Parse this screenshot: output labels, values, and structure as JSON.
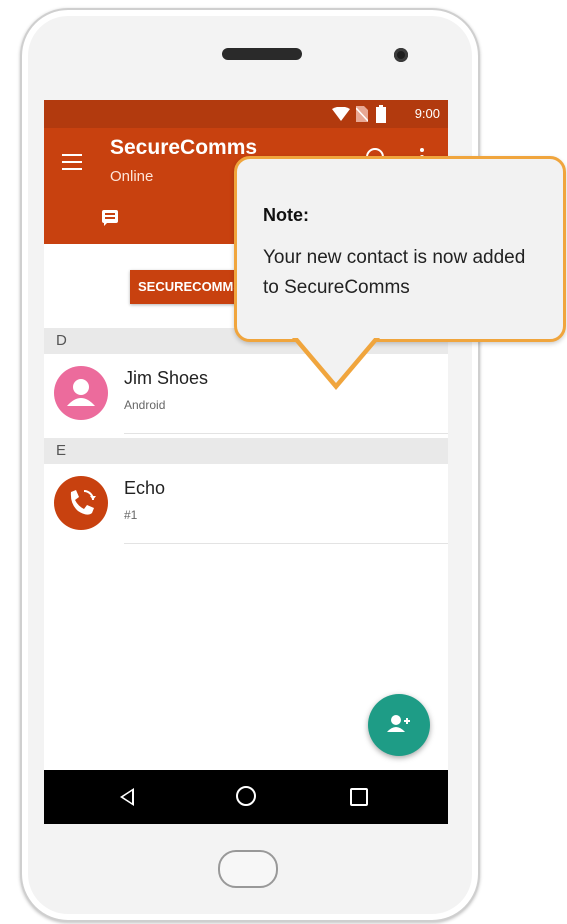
{
  "status_bar": {
    "time": "9:00",
    "icons": [
      "wifi-icon",
      "no-sim-icon",
      "battery-icon"
    ]
  },
  "app_bar": {
    "title": "SecureComms",
    "subtitle": "Online",
    "icons": [
      "menu-icon",
      "search-icon",
      "more-vert-icon",
      "chat-icon"
    ]
  },
  "promo_button": {
    "label": "SECURECOMMS"
  },
  "sections": [
    {
      "letter": "D",
      "contacts": [
        {
          "name": "Jim Shoes",
          "detail": "Android",
          "avatar_icon": "person-icon",
          "avatar_color": "#ec6b9c"
        }
      ]
    },
    {
      "letter": "E",
      "contacts": [
        {
          "name": "Echo",
          "detail": "#1",
          "avatar_icon": "phone-swap-icon",
          "avatar_color": "#c8410f"
        }
      ]
    }
  ],
  "fab": {
    "icon": "add-contact-icon",
    "color": "#1e9c86"
  },
  "nav_bar": {
    "icons": [
      "back-icon",
      "home-icon",
      "recent-apps-icon"
    ]
  },
  "callout": {
    "title": "Note:",
    "text": "Your new contact is now added to SecureComms",
    "border_color": "#f0a53d"
  },
  "colors": {
    "accent": "#c8410f",
    "status_bar": "#b23a0e"
  }
}
